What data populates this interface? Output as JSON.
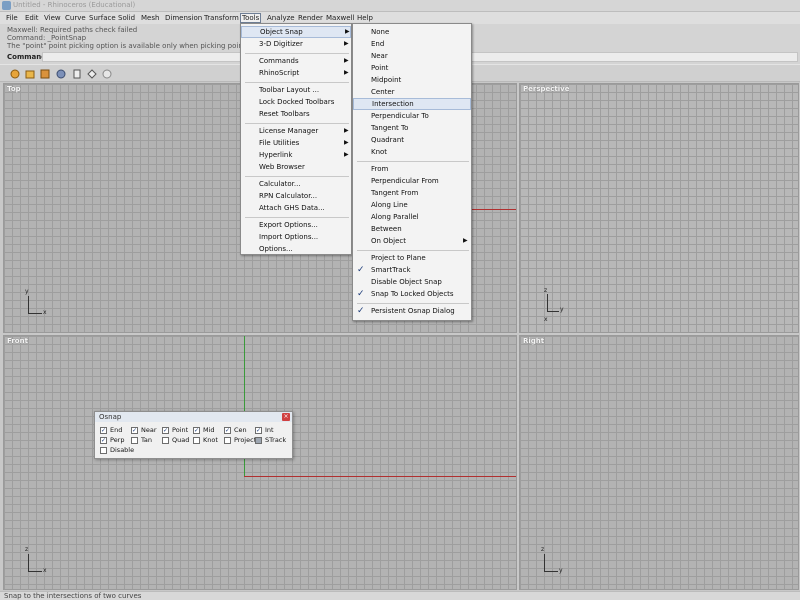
{
  "window": {
    "title": "Untitled - Rhinoceros (Educational)"
  },
  "menubar": {
    "items": [
      "File",
      "Edit",
      "View",
      "Curve",
      "Surface",
      "Solid",
      "Mesh",
      "Dimension",
      "Transform",
      "Tools",
      "Analyze",
      "Render",
      "Maxwell",
      "Help"
    ],
    "active": "Tools"
  },
  "command_history": [
    "Maxwell: Required paths check failed",
    "Command: _PointSnap",
    "The \"point\" point picking option is available only when picking points."
  ],
  "command_prompt": {
    "label": "Command:",
    "value": ""
  },
  "viewports": {
    "top": "Top",
    "perspective": "Perspective",
    "front": "Front",
    "right": "Right"
  },
  "axes": {
    "x": "x",
    "y": "y",
    "z": "z"
  },
  "tools_menu": {
    "items": [
      "Object Snap",
      "3-D Digitizer",
      "Commands",
      "RhinoScript",
      "Toolbar Layout ...",
      "Lock Docked Toolbars",
      "Reset Toolbars",
      "License Manager",
      "File Utilities",
      "Hyperlink",
      "Web Browser",
      "Calculator...",
      "RPN Calculator...",
      "Attach GHS Data...",
      "Export Options...",
      "Import Options...",
      "Options..."
    ],
    "highlighted": "Object Snap"
  },
  "osnap_menu": {
    "items": [
      "None",
      "End",
      "Near",
      "Point",
      "Midpoint",
      "Center",
      "Intersection",
      "Perpendicular To",
      "Tangent To",
      "Quadrant",
      "Knot",
      "From",
      "Perpendicular From",
      "Tangent From",
      "Along Line",
      "Along Parallel",
      "Between",
      "On Object",
      "Project to Plane",
      "SmartTrack",
      "Disable Object Snap",
      "Snap To Locked Objects",
      "Persistent Osnap Dialog"
    ],
    "highlighted": "Intersection",
    "checked": [
      "SmartTrack",
      "Snap To Locked Objects",
      "Persistent Osnap Dialog"
    ],
    "check_glyph": "✓"
  },
  "osnap_dialog": {
    "title": "Osnap",
    "close": "×",
    "options": [
      {
        "label": "End",
        "checked": true
      },
      {
        "label": "Near",
        "checked": true
      },
      {
        "label": "Point",
        "checked": true
      },
      {
        "label": "Mid",
        "checked": true
      },
      {
        "label": "Cen",
        "checked": true
      },
      {
        "label": "Int",
        "checked": true
      },
      {
        "label": "Perp",
        "checked": true
      },
      {
        "label": "Tan",
        "checked": false
      },
      {
        "label": "Quad",
        "checked": false
      },
      {
        "label": "Knot",
        "checked": false
      },
      {
        "label": "Project",
        "checked": false
      },
      {
        "label": "STrack",
        "checked": true
      },
      {
        "label": "Disable",
        "checked": false
      }
    ]
  },
  "status_bar": {
    "text": "Snap to the intersections of two curves"
  },
  "colors": {
    "menu_highlight": "#dfe7f3",
    "axis_red": "#b03030",
    "axis_green": "#3a9a3a",
    "checkmark": "#1b3a78"
  }
}
